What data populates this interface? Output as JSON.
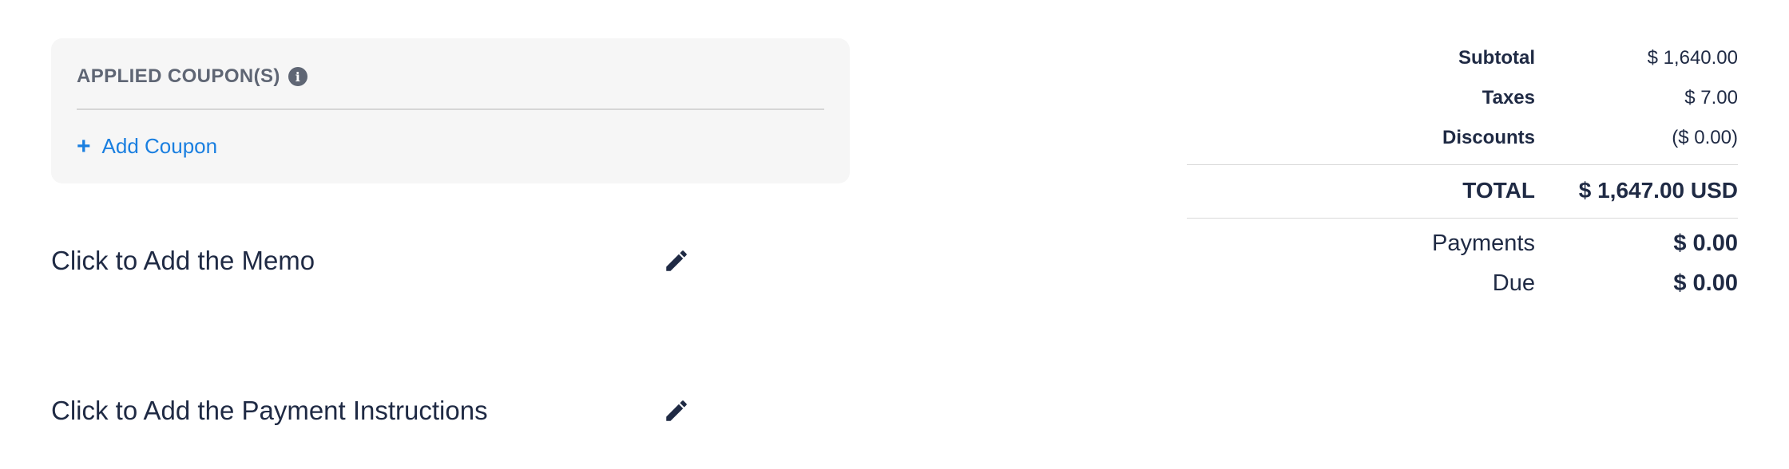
{
  "coupons": {
    "title": "APPLIED COUPON(S)",
    "info_icon": "info-circle-icon",
    "add_icon": "plus-icon",
    "add_label": "Add Coupon"
  },
  "memo": {
    "label": "Click to Add the Memo",
    "icon": "pencil-icon"
  },
  "payment_instructions": {
    "label": "Click to Add the Payment Instructions",
    "icon": "pencil-icon"
  },
  "totals": {
    "subtotal_label": "Subtotal",
    "subtotal_value": "$ 1,640.00",
    "taxes_label": "Taxes",
    "taxes_value": "$ 7.00",
    "discounts_label": "Discounts",
    "discounts_value": "($ 0.00)",
    "total_label": "TOTAL",
    "total_value": "$ 1,647.00 USD",
    "payments_label": "Payments",
    "payments_value": "$ 0.00",
    "due_label": "Due",
    "due_value": "$ 0.00"
  },
  "colors": {
    "accent": "#1a7fe0",
    "text": "#1f2a44",
    "muted": "#5f6674",
    "panel_bg": "#f6f6f6"
  }
}
